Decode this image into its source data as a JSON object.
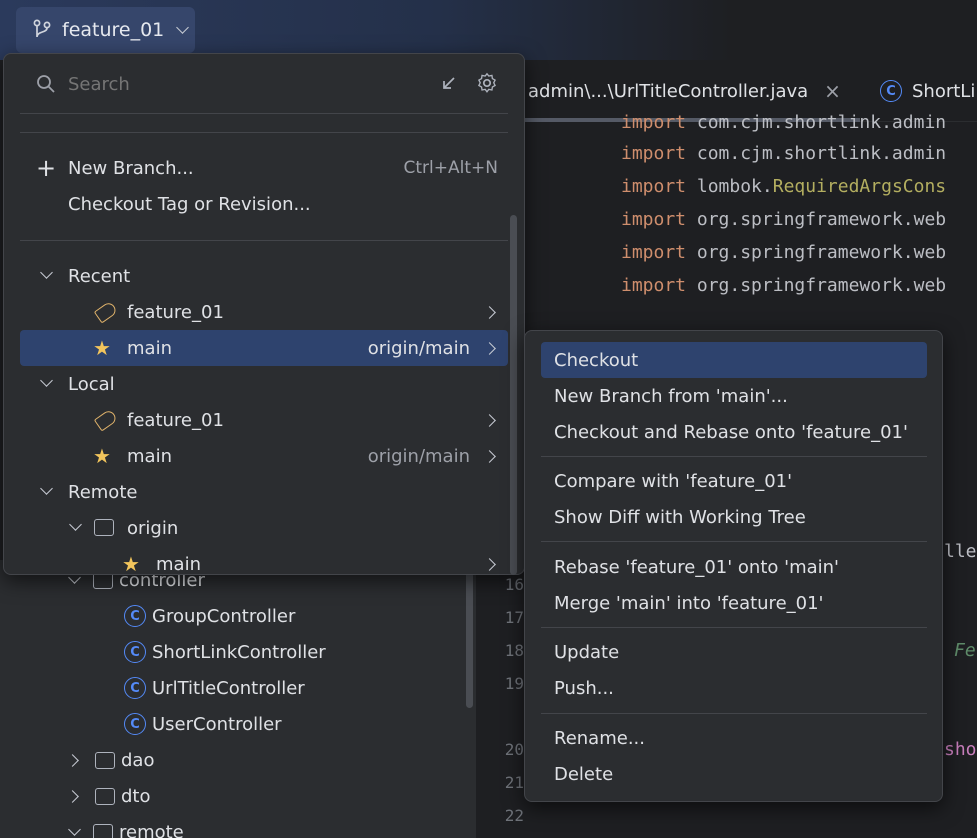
{
  "branch_widget": {
    "label": "feature_01"
  },
  "popup": {
    "search_placeholder": "Search",
    "actions": [
      {
        "label": "New Branch...",
        "shortcut": "Ctrl+Alt+N"
      },
      {
        "label": "Checkout Tag or Revision..."
      }
    ],
    "groups": {
      "recent": "Recent",
      "local": "Local",
      "remote": "Remote",
      "origin": "origin"
    },
    "recent": [
      {
        "name": "feature_01",
        "tracking": ""
      },
      {
        "name": "main",
        "tracking": "origin/main"
      }
    ],
    "local": [
      {
        "name": "feature_01",
        "tracking": ""
      },
      {
        "name": "main",
        "tracking": "origin/main"
      }
    ],
    "remote_origin": [
      {
        "name": "main"
      }
    ]
  },
  "context_menu": {
    "items": [
      "Checkout",
      "New Branch from 'main'...",
      "Checkout and Rebase onto 'feature_01'",
      "Compare with 'feature_01'",
      "Show Diff with Working Tree",
      "Rebase 'feature_01' onto 'main'",
      "Merge 'main' into 'feature_01'",
      "Update",
      "Push...",
      "Rename...",
      "Delete"
    ]
  },
  "editor": {
    "tabs": [
      {
        "label": "admin\\...\\UrlTitleController.java"
      },
      {
        "label": "ShortLi"
      }
    ],
    "code_lines": [
      {
        "kw": "import",
        "text": " com.cjm.shortlink.admin"
      },
      {
        "kw": "import",
        "text": " com.cjm.shortlink.admin"
      },
      {
        "kw": "import",
        "text": " lombok.",
        "ann": "RequiredArgsCons"
      },
      {
        "kw": "import",
        "text": " org.springframework.web"
      },
      {
        "kw": "import",
        "text": " org.springframework.web"
      },
      {
        "kw": "import",
        "text": " org.springframework.web"
      }
    ],
    "line_numbers": [
      "16",
      "17",
      "18",
      "19",
      "20",
      "21",
      "22"
    ],
    "fragments": [
      "lle",
      "Fe",
      "sho"
    ]
  },
  "project_tree": {
    "controller_folder": "controller",
    "classes": [
      "GroupController",
      "ShortLinkController",
      "UrlTitleController",
      "UserController"
    ],
    "folders": [
      "dao",
      "dto",
      "remote"
    ]
  },
  "colors": {
    "accent": "#2e436e",
    "class_icon": "#548af7",
    "star": "#f2c55c",
    "keyword": "#cf8e6d"
  }
}
